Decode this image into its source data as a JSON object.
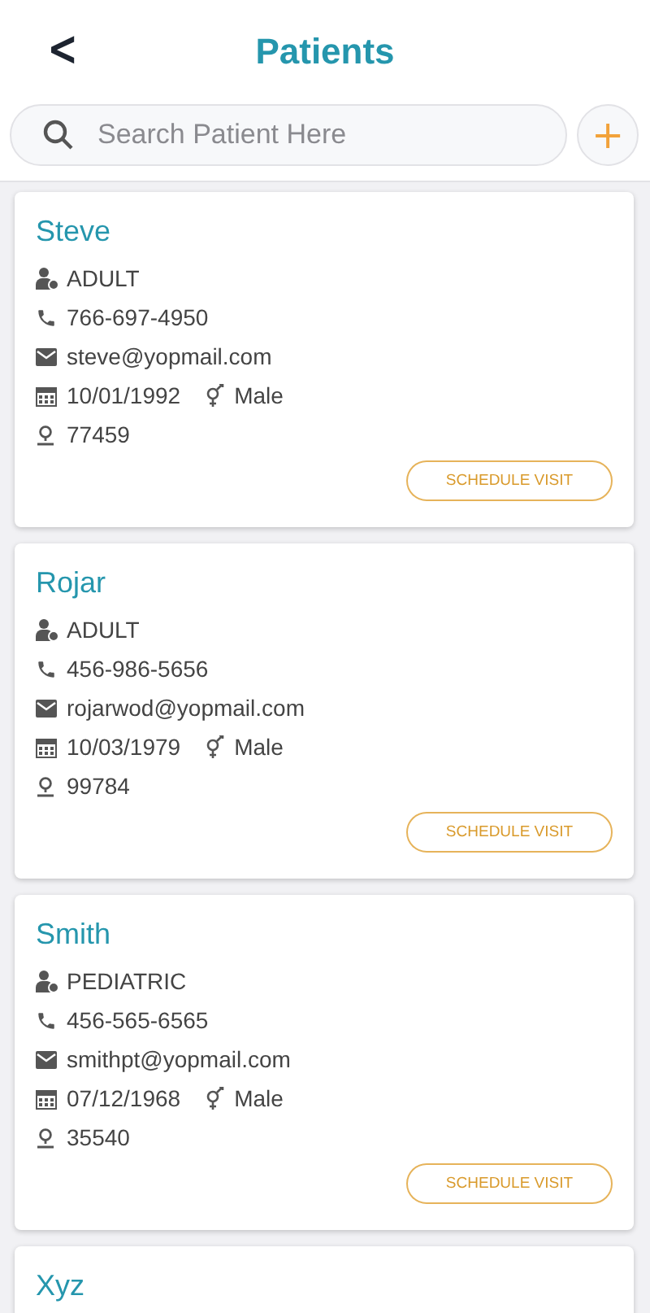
{
  "header": {
    "back": "<",
    "title": "Patients"
  },
  "search": {
    "placeholder": "Search Patient Here",
    "add": "+"
  },
  "patients": [
    {
      "name": "Steve",
      "category": "ADULT",
      "phone": "766-697-4950",
      "email": "steve@yopmail.com",
      "dob": "10/01/1992",
      "gender": "Male",
      "zip": "77459",
      "action": "SCHEDULE VISIT"
    },
    {
      "name": "Rojar",
      "category": "ADULT",
      "phone": "456-986-5656",
      "email": "rojarwod@yopmail.com",
      "dob": "10/03/1979",
      "gender": "Male",
      "zip": "99784",
      "action": "SCHEDULE VISIT"
    },
    {
      "name": "Smith",
      "category": "PEDIATRIC",
      "phone": "456-565-6565",
      "email": "smithpt@yopmail.com",
      "dob": "07/12/1968",
      "gender": "Male",
      "zip": "35540",
      "action": "SCHEDULE VISIT"
    },
    {
      "name": "Xyz"
    }
  ]
}
